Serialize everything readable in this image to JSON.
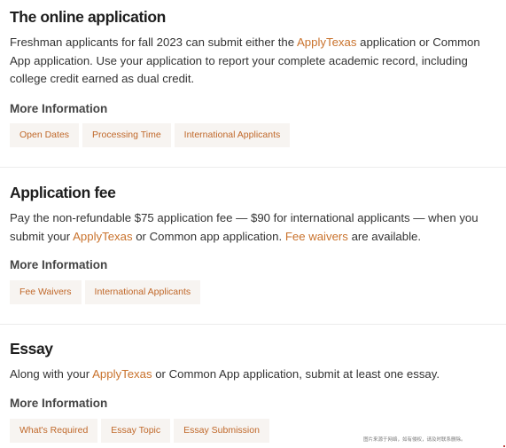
{
  "sections": [
    {
      "title": "The online application",
      "text_parts": [
        "Freshman applicants for fall 2023 can submit either the ",
        "ApplyTexas",
        " application or Common App application. Use your application to report your complete academic record, including college credit earned as dual credit."
      ],
      "more_label": "More Information",
      "links": [
        "Open Dates",
        "Processing Time",
        "International Applicants"
      ]
    },
    {
      "title": "Application fee",
      "text_parts": [
        "Pay the non-refundable $75 application fee — $90 for international applicants — when you submit your ",
        "ApplyTexas",
        " or Common app application. ",
        "Fee waivers",
        " are available."
      ],
      "more_label": "More Information",
      "links": [
        "Fee Waivers",
        "International Applicants"
      ]
    },
    {
      "title": "Essay",
      "text_parts": [
        "Along with your ",
        "ApplyTexas",
        " or Common App application, submit at least one essay."
      ],
      "more_label": "More Information",
      "links": [
        "What's Required",
        "Essay Topic",
        "Essay Submission"
      ]
    }
  ],
  "watermark": "图片来源于网络，如有侵权，请及时联系删除。",
  "colors": {
    "link": "#c9722c",
    "chip_bg": "#f7f4f1",
    "chip_text": "#c0682a"
  }
}
